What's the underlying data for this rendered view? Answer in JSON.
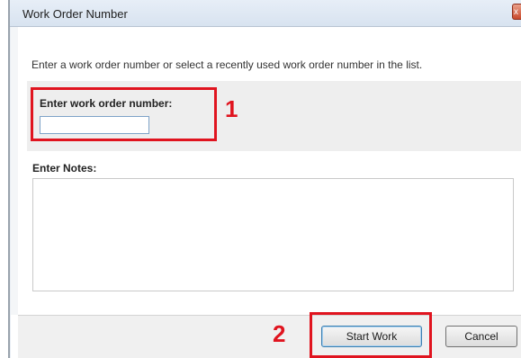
{
  "window": {
    "title": "Work Order Number",
    "close_glyph": "x",
    "close_icon": "close-icon"
  },
  "main": {
    "instruction": "Enter a work order number or select a recently used work order number in the list.",
    "work_order_label": "Enter work order number:",
    "work_order_value": "",
    "notes_label": "Enter Notes:",
    "notes_value": ""
  },
  "footer": {
    "start_label": "Start Work",
    "cancel_label": "Cancel"
  },
  "annotations": {
    "callout_1": "1",
    "callout_2": "2",
    "highlight_color": "#e0141f"
  }
}
